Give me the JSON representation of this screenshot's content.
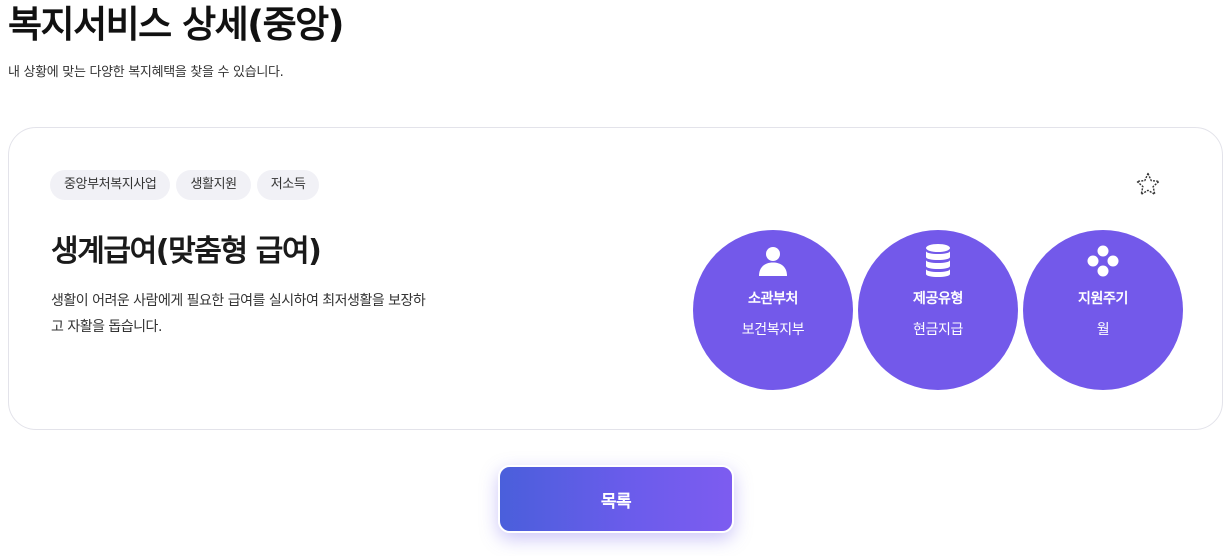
{
  "header": {
    "title": "복지서비스 상세(중앙)",
    "subtitle": "내 상황에 맞는 다양한 복지혜택을 찾을 수 있습니다."
  },
  "service": {
    "tags": [
      "중앙부처복지사업",
      "생활지원",
      "저소득"
    ],
    "favorite_icon": "star-outline-icon",
    "title": "생계급여(맞춤형 급여)",
    "description": "생활이 어려운 사람에게 필요한 급여를 실시하여 최저생활을 보장하고 자활을 돕습니다.",
    "info": [
      {
        "icon": "person-icon",
        "label": "소관부처",
        "value": "보건복지부"
      },
      {
        "icon": "database-icon",
        "label": "제공유형",
        "value": "현금지급"
      },
      {
        "icon": "four-dots-icon",
        "label": "지원주기",
        "value": "월"
      }
    ]
  },
  "actions": {
    "list_label": "목록"
  },
  "colors": {
    "accent": "#7359ea",
    "tag_bg": "#f1f1f6",
    "button_gradient_start": "#4a5fdb",
    "button_gradient_end": "#7d5cf0"
  }
}
